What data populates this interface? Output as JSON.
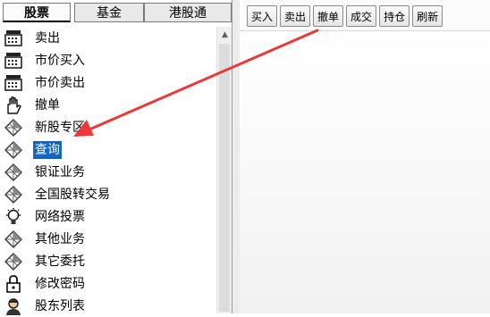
{
  "tabs": [
    {
      "label": "股票",
      "active": true
    },
    {
      "label": "基金",
      "active": false
    },
    {
      "label": "港股通",
      "active": false
    }
  ],
  "menu": [
    {
      "label": "卖出",
      "icon": "cash-register-icon",
      "selected": false
    },
    {
      "label": "市价买入",
      "icon": "cash-register-icon",
      "selected": false
    },
    {
      "label": "市价卖出",
      "icon": "cash-register-icon",
      "selected": false
    },
    {
      "label": "撤单",
      "icon": "hand-icon",
      "selected": false
    },
    {
      "label": "新股专区",
      "icon": "diamond-icon",
      "selected": false
    },
    {
      "label": "查询",
      "icon": "diamond-icon",
      "selected": true
    },
    {
      "label": "银证业务",
      "icon": "diamond-icon",
      "selected": false
    },
    {
      "label": "全国股转交易",
      "icon": "diamond-icon",
      "selected": false
    },
    {
      "label": "网络投票",
      "icon": "lightbulb-icon",
      "selected": false
    },
    {
      "label": "其他业务",
      "icon": "diamond-icon",
      "selected": false
    },
    {
      "label": "其它委托",
      "icon": "diamond-icon",
      "selected": false
    },
    {
      "label": "修改密码",
      "icon": "lock-icon",
      "selected": false
    },
    {
      "label": "股东列表",
      "icon": "person-icon",
      "selected": false
    }
  ],
  "toolbar": {
    "buy_label": "买入",
    "sell_label": "卖出",
    "cancel_label": "撤单",
    "filled_label": "成交",
    "position_label": "持仓",
    "refresh_label": "刷新"
  },
  "colors": {
    "selection": "#1565c0",
    "arrow": "#e83a3a"
  }
}
